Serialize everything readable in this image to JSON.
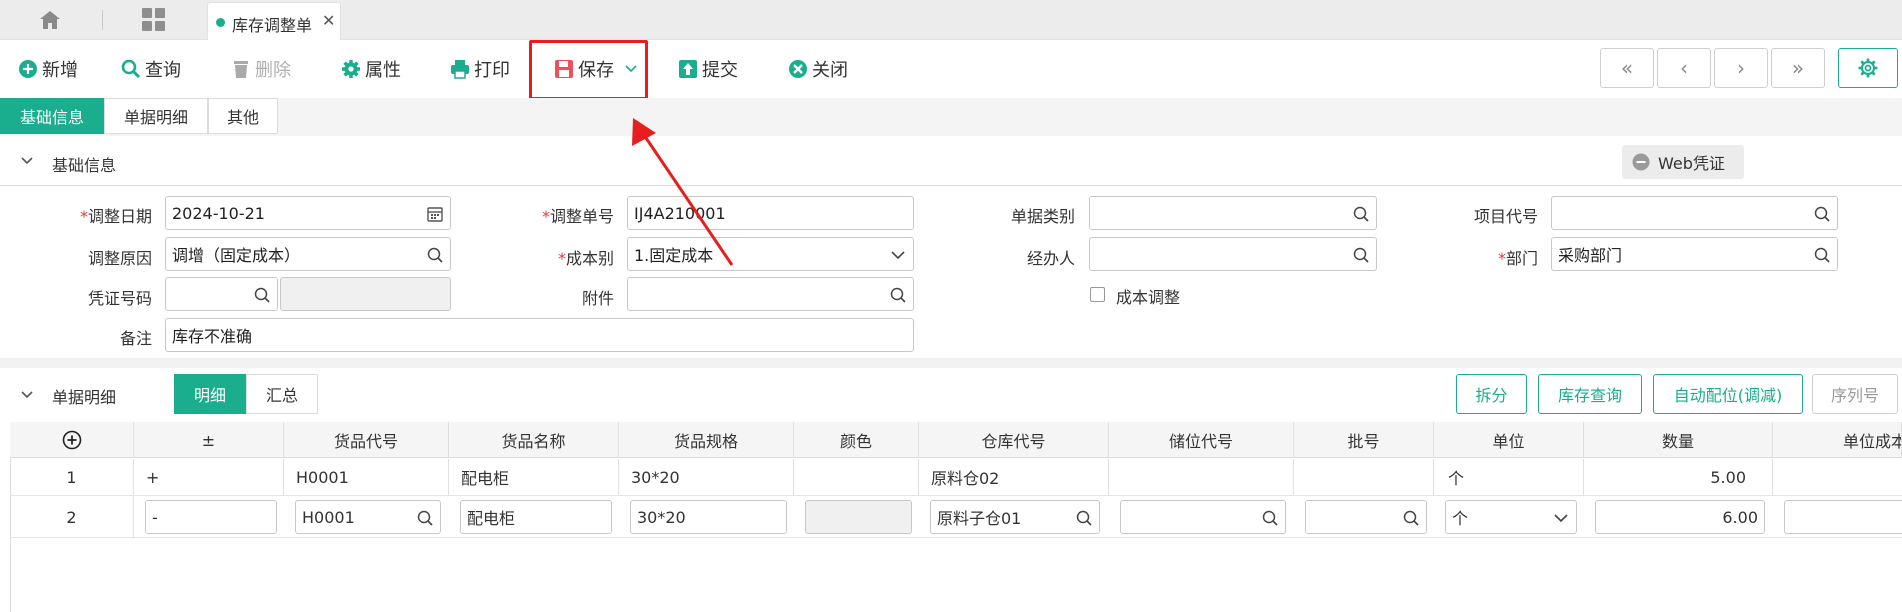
{
  "tabbar": {
    "active_tab": "库存调整单",
    "close_glyph": "✕"
  },
  "toolbar": {
    "new": "新增",
    "query": "查询",
    "delete": "删除",
    "properties": "属性",
    "print": "打印",
    "save": "保存",
    "submit": "提交",
    "close": "关闭",
    "nav": [
      "«",
      "‹",
      "›",
      "»"
    ]
  },
  "section_tabs": [
    "基础信息",
    "单据明细",
    "其他"
  ],
  "basic": {
    "title": "基础信息",
    "web_voucher": "Web凭证",
    "fields": {
      "adjust_date": {
        "label": "调整日期",
        "value": "2024-10-21"
      },
      "adjust_no": {
        "label": "调整单号",
        "value": "IJ4A210001"
      },
      "doc_type": {
        "label": "单据类别",
        "value": ""
      },
      "project_code": {
        "label": "项目代号",
        "value": ""
      },
      "adjust_reason": {
        "label": "调整原因",
        "value": "调增（固定成本）"
      },
      "cost_type": {
        "label": "成本别",
        "value": "1.固定成本"
      },
      "handler": {
        "label": "经办人",
        "value": ""
      },
      "department": {
        "label": "部门",
        "value": "采购部门"
      },
      "voucher_no": {
        "label": "凭证号码",
        "value": ""
      },
      "attachment": {
        "label": "附件",
        "value": ""
      },
      "cost_adjust": {
        "label": "成本调整"
      },
      "remark": {
        "label": "备注",
        "value": "库存不准确"
      }
    },
    "required_mark": "*"
  },
  "detail": {
    "title": "单据明细",
    "tabs": [
      "明细",
      "汇总"
    ],
    "buttons": [
      "拆分",
      "库存查询",
      "自动配位(调减)",
      "序列号"
    ],
    "columns": [
      "±",
      "货品代号",
      "货品名称",
      "货品规格",
      "颜色",
      "仓库代号",
      "储位代号",
      "批号",
      "单位",
      "数量",
      "单位成本"
    ],
    "rows": [
      {
        "no": "1",
        "sign": "+",
        "code": "H0001",
        "name": "配电柜",
        "spec": "30*20",
        "color": "",
        "warehouse": "原料仓02",
        "location": "",
        "batch": "",
        "unit": "个",
        "qty": "5.00"
      },
      {
        "no": "2",
        "sign": "-",
        "code": "H0001",
        "name": "配电柜",
        "spec": "30*20",
        "color": "",
        "warehouse": "原料子仓01",
        "location": "",
        "batch": "",
        "unit": "个",
        "qty": "6.00"
      }
    ]
  },
  "colors": {
    "accent": "#1aad8e",
    "highlight": "#e81e1e",
    "required": "#e53935"
  }
}
